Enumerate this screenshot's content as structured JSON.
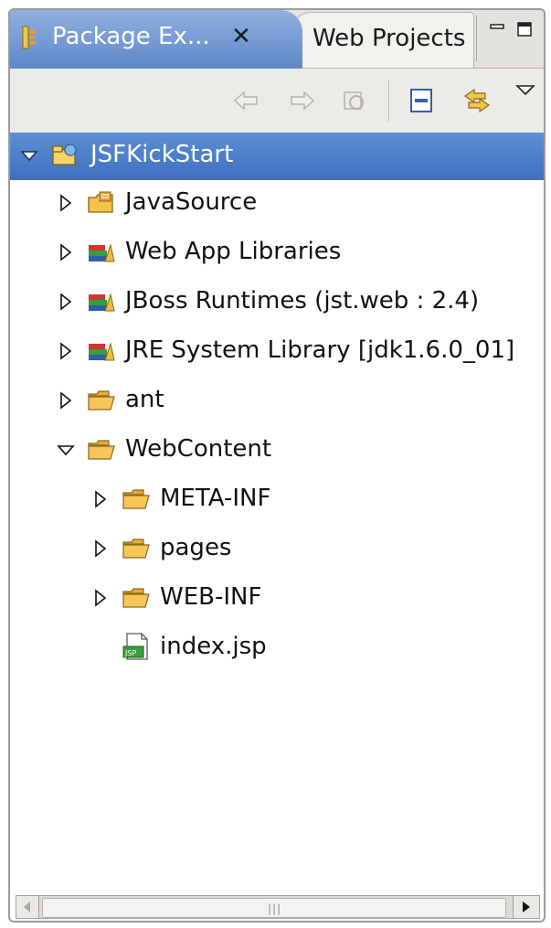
{
  "tabs": {
    "active_label": "Package Ex...",
    "inactive_label": "Web Projects"
  },
  "toolbar": {
    "buttons": [
      "back-icon",
      "forward-icon",
      "up-icon",
      "collapse-all-icon",
      "link-with-editor-icon",
      "view-menu-icon"
    ]
  },
  "tree": {
    "root": "JSFKickStart",
    "items": [
      {
        "label": "JavaSource",
        "icon": "source-folder-icon",
        "expanded": false
      },
      {
        "label": "Web App Libraries",
        "icon": "library-icon",
        "expanded": false
      },
      {
        "label": "JBoss Runtimes (jst.web : 2.4)",
        "icon": "library-icon",
        "expanded": false
      },
      {
        "label": "JRE System Library [jdk1.6.0_01]",
        "icon": "library-icon",
        "expanded": false
      },
      {
        "label": "ant",
        "icon": "folder-icon",
        "expanded": false
      },
      {
        "label": "WebContent",
        "icon": "folder-icon",
        "expanded": true
      },
      {
        "label": "META-INF",
        "icon": "folder-icon",
        "expanded": false
      },
      {
        "label": "pages",
        "icon": "folder-icon",
        "expanded": false
      },
      {
        "label": "WEB-INF",
        "icon": "folder-icon",
        "expanded": false
      },
      {
        "label": "index.jsp",
        "icon": "jsp-file-icon"
      }
    ]
  },
  "colors": {
    "selection": "#4a7cc7",
    "tab_active": "#7a9fd8",
    "folder": "#f2b84b"
  }
}
